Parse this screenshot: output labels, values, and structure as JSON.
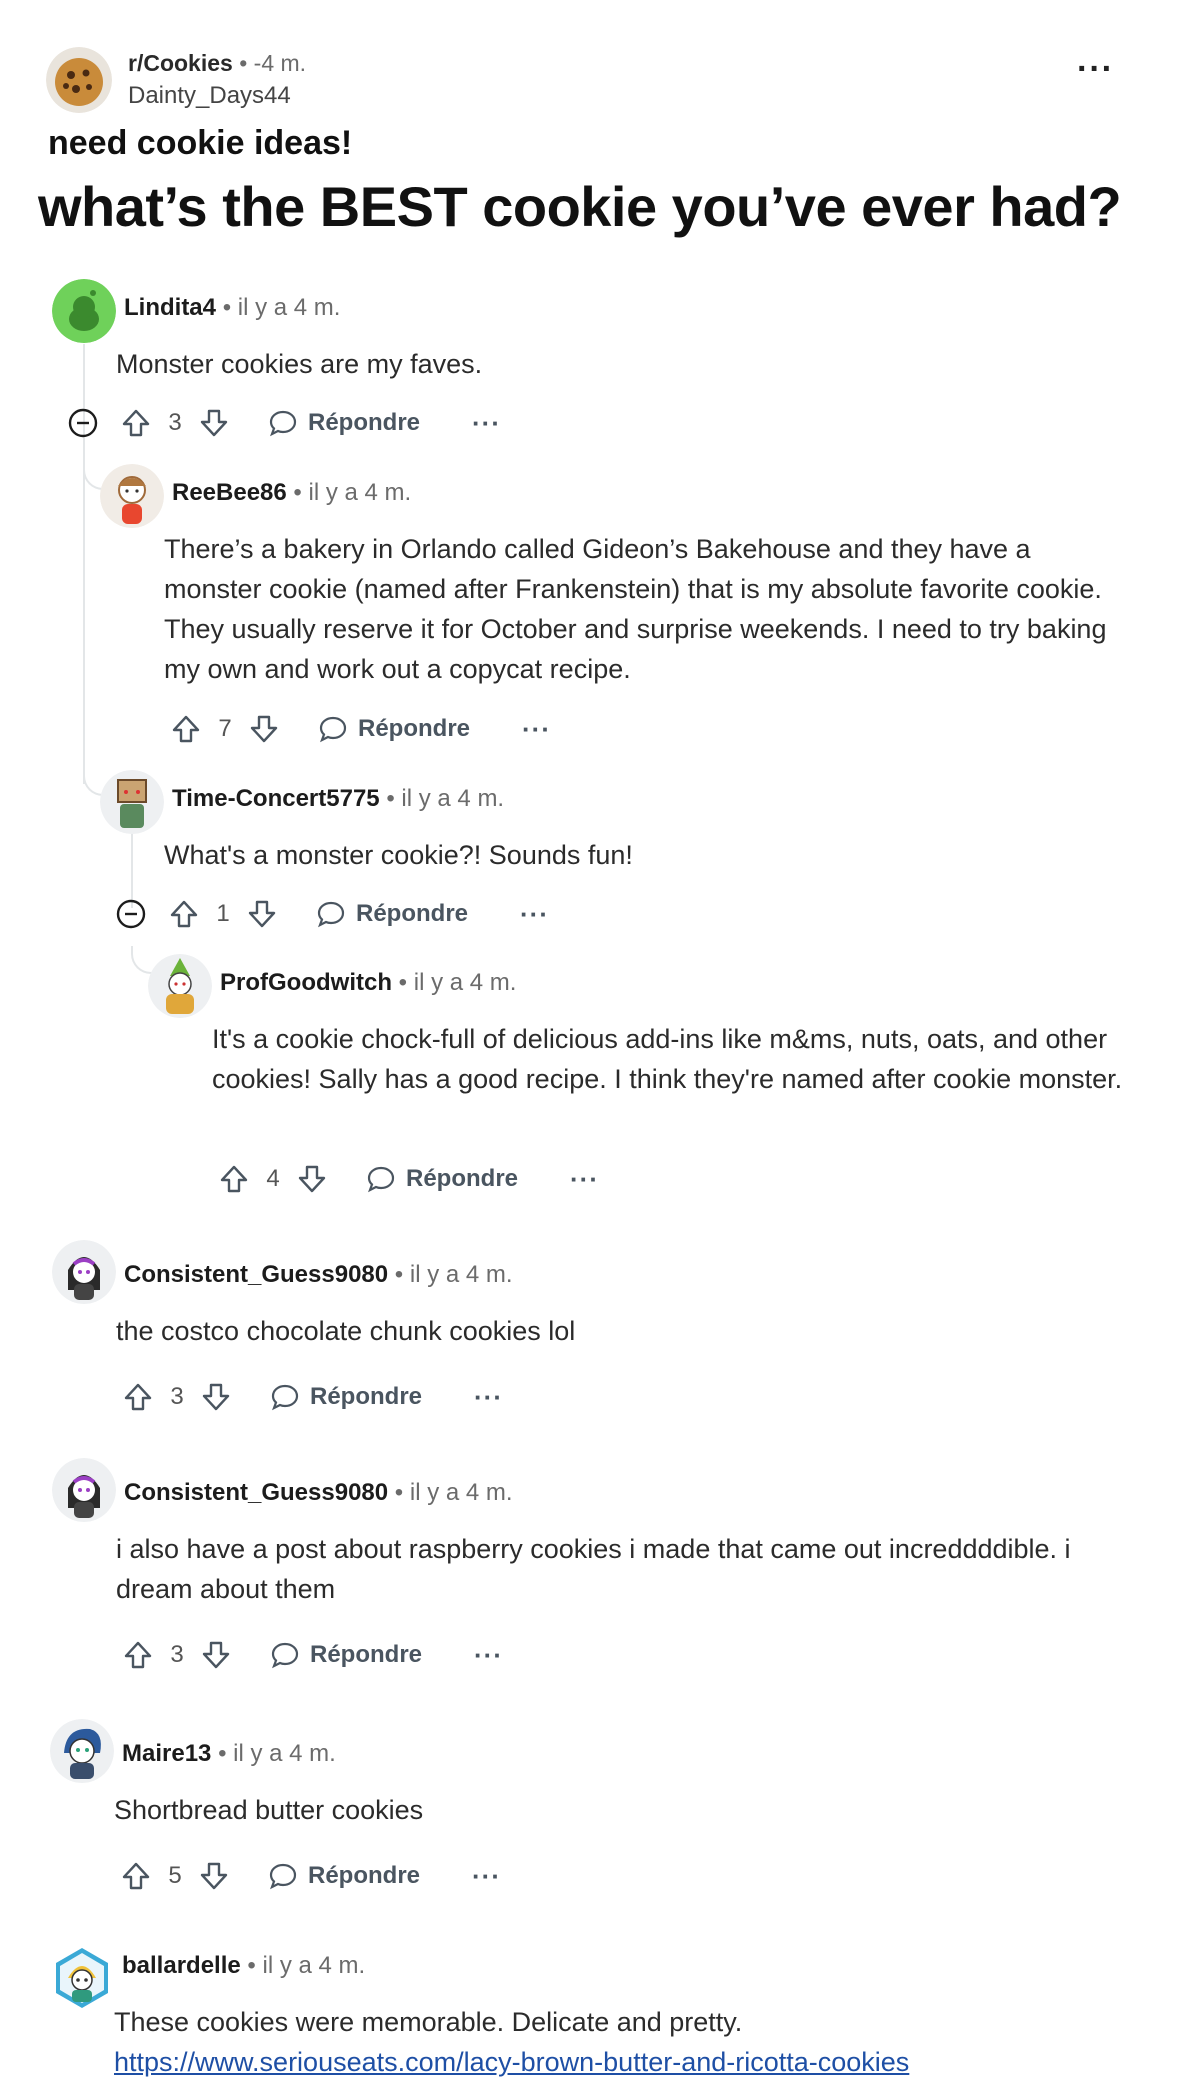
{
  "post": {
    "subreddit": "r/Cookies",
    "time": "-4 m.",
    "author": "Dainty_Days44",
    "flair": "need cookie ideas!",
    "title": "what’s the BEST cookie you’ve ever had?",
    "more": "···"
  },
  "labels": {
    "separator": "•",
    "reply": "Répondre",
    "more": "···"
  },
  "comments": [
    {
      "user": "Lindita4",
      "time": "il y a 4 m.",
      "text": "Monster cookies are my faves.",
      "score": "3"
    },
    {
      "user": "ReeBee86",
      "time": "il y a 4 m.",
      "text": "There’s a bakery in Orlando called Gideon’s Bakehouse and they have a monster cookie (named after Frankenstein) that is my absolute favorite cookie. They usually reserve it for October and surprise weekends. I need to try baking my own and work out a copycat recipe.",
      "score": "7"
    },
    {
      "user": "Time-Concert5775",
      "time": "il y a 4 m.",
      "text": "What's a monster cookie?! Sounds fun!",
      "score": "1"
    },
    {
      "user": "ProfGoodwitch",
      "time": "il y a 4 m.",
      "text": "It's a cookie chock-full of delicious add-ins like m&ms, nuts, oats, and other cookies! Sally has a good recipe. I think they're named after cookie monster.",
      "score": "4"
    },
    {
      "user": "Consistent_Guess9080",
      "time": "il y a 4 m.",
      "text": "the costco chocolate chunk cookies lol",
      "score": "3"
    },
    {
      "user": "Consistent_Guess9080",
      "time": "il y a 4 m.",
      "text": "i also have a post about raspberry cookies i made that came out increddddible. i dream about them",
      "score": "3"
    },
    {
      "user": "Maire13",
      "time": "il y a 4 m.",
      "text": "Shortbread butter cookies",
      "score": "5"
    },
    {
      "user": "ballardelle",
      "time": "il y a 4 m.",
      "text": "These cookies were memorable. Delicate and pretty.",
      "link": "https://www.seriouseats.com/lacy-brown-butter-and-ricotta-cookies"
    }
  ]
}
